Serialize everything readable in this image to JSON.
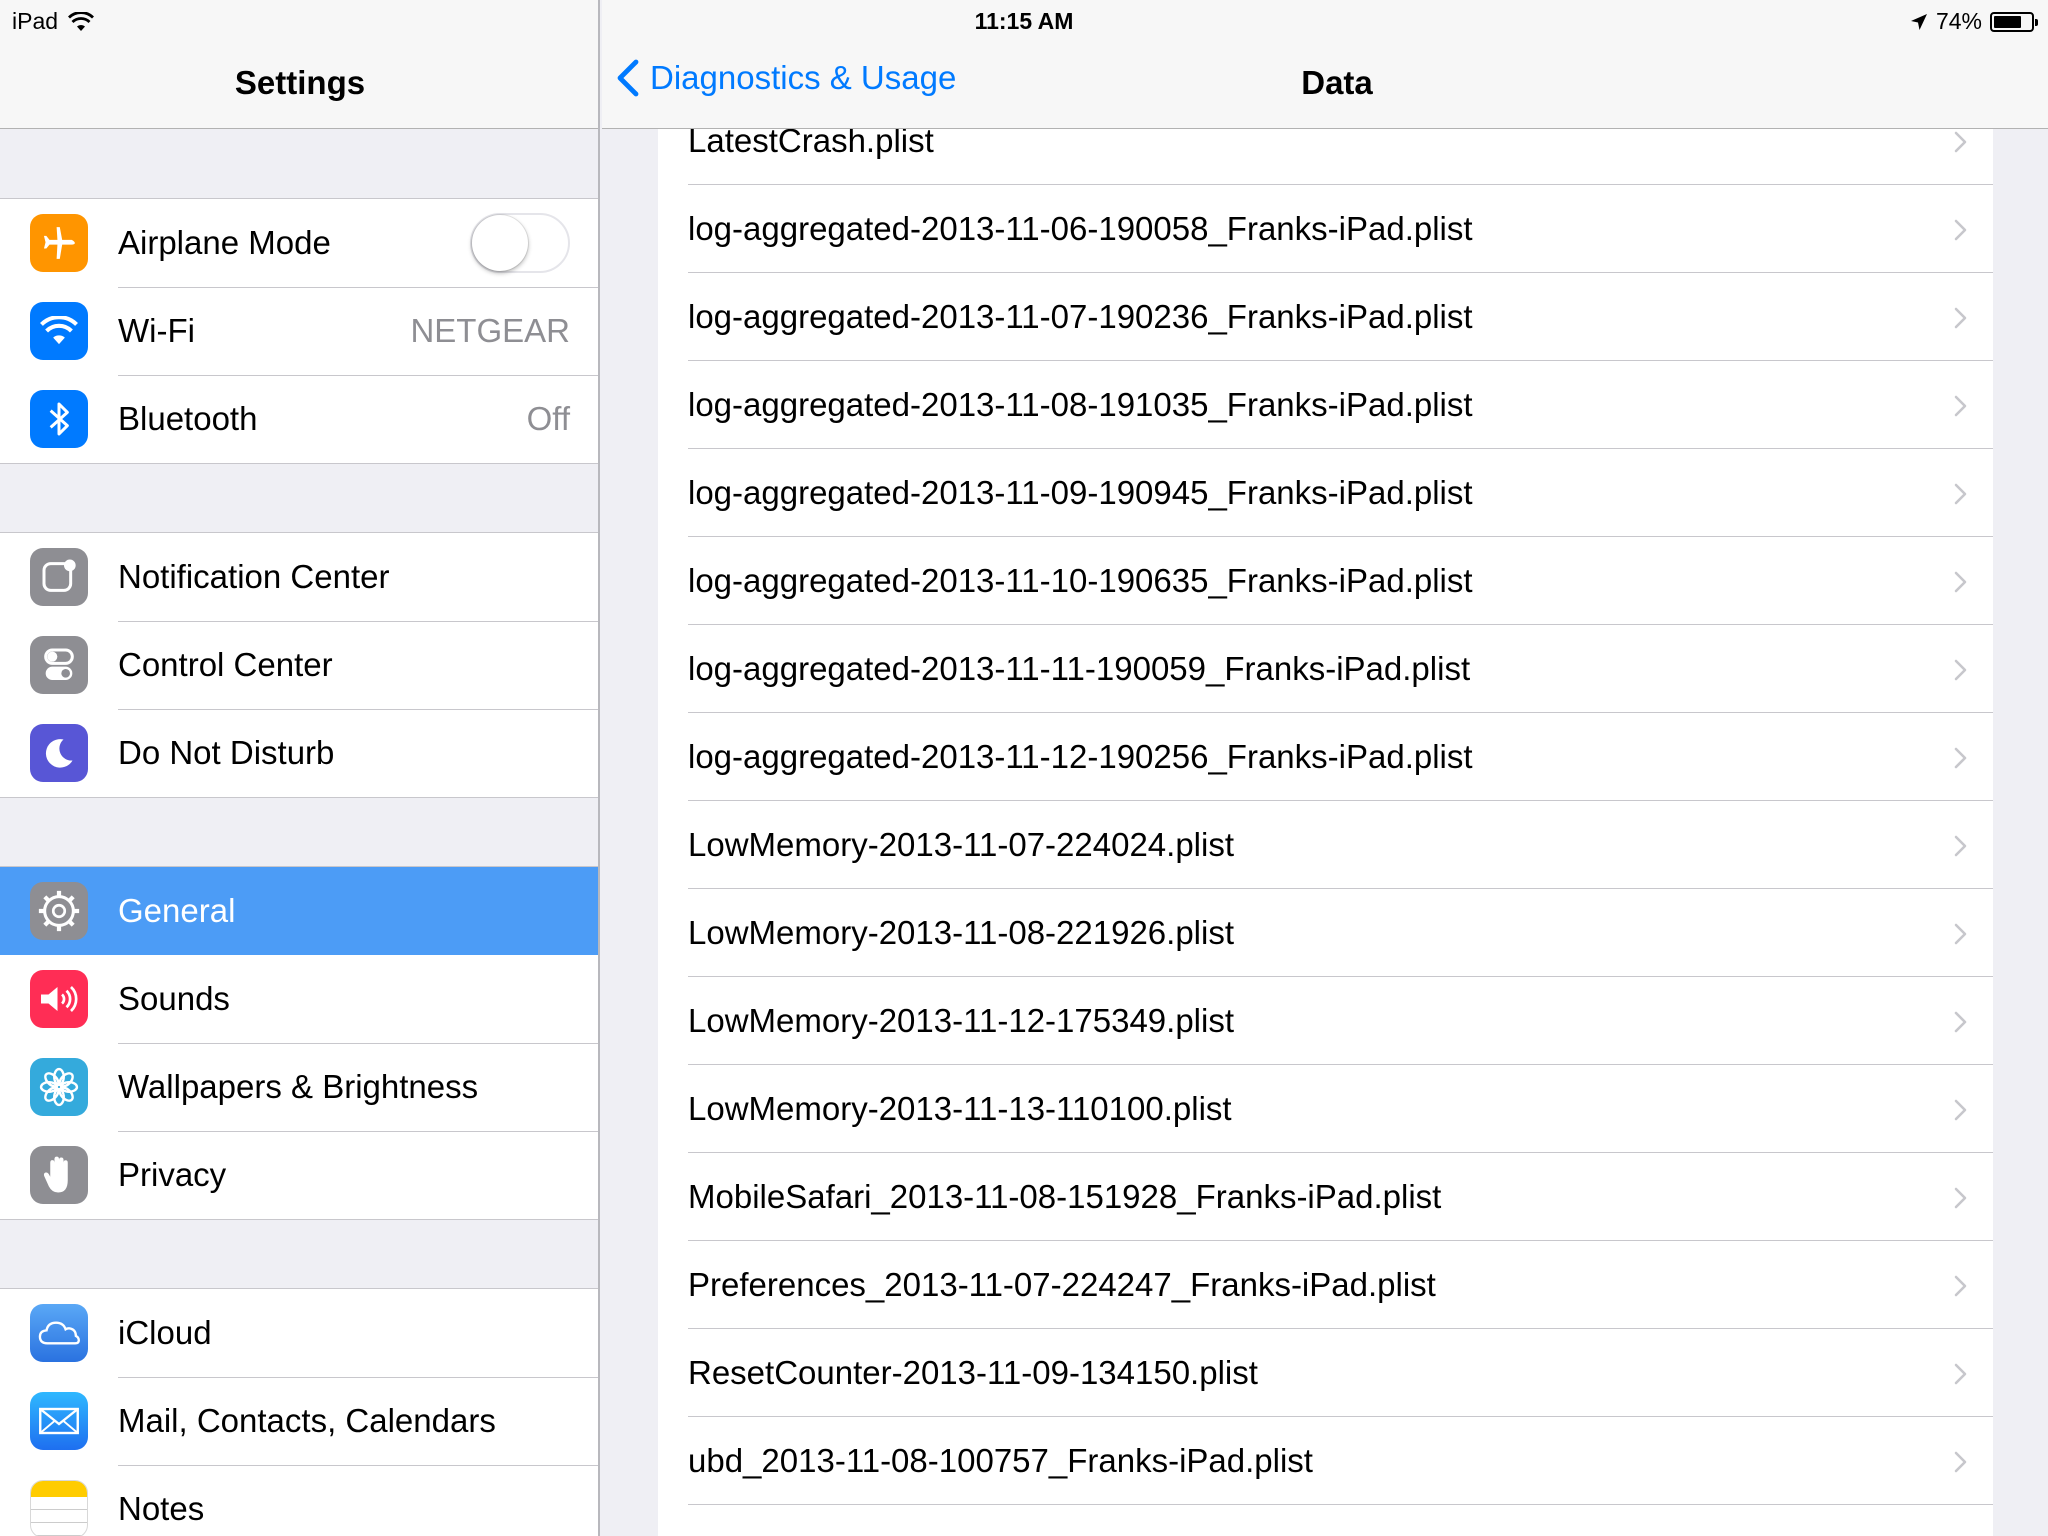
{
  "status": {
    "device": "iPad",
    "time": "11:15 AM",
    "battery": "74%",
    "battery_level": 0.74
  },
  "master": {
    "title": "Settings",
    "groups": [
      [
        {
          "label": "Airplane Mode",
          "icon": "airplane-icon",
          "color": "#ff9500",
          "toggle": false
        },
        {
          "label": "Wi-Fi",
          "value": "NETGEAR",
          "icon": "wifi-icon",
          "color": "#007aff"
        },
        {
          "label": "Bluetooth",
          "value": "Off",
          "icon": "bluetooth-icon",
          "color": "#007aff"
        }
      ],
      [
        {
          "label": "Notification Center",
          "icon": "notification-center-icon",
          "color": "#8e8e93"
        },
        {
          "label": "Control Center",
          "icon": "control-center-icon",
          "color": "#8e8e93"
        },
        {
          "label": "Do Not Disturb",
          "icon": "moon-icon",
          "color": "#5856d6"
        }
      ],
      [
        {
          "label": "General",
          "icon": "gear-icon",
          "color": "#8e8e93",
          "selected": true
        },
        {
          "label": "Sounds",
          "icon": "speaker-icon",
          "color": "#ff2d55"
        },
        {
          "label": "Wallpapers & Brightness",
          "icon": "flower-icon",
          "color": "#34aadc"
        },
        {
          "label": "Privacy",
          "icon": "hand-icon",
          "color": "#8e8e93"
        }
      ],
      [
        {
          "label": "iCloud",
          "icon": "cloud-icon",
          "color": "#3f8ff0"
        },
        {
          "label": "Mail, Contacts, Calendars",
          "icon": "envelope-icon",
          "color": "#1e90ff"
        },
        {
          "label": "Notes",
          "icon": "notes-icon",
          "color": "#ffffff"
        }
      ]
    ]
  },
  "detail": {
    "back_label": "Diagnostics & Usage",
    "title": "Data",
    "files": [
      "LatestCrash.plist",
      "log-aggregated-2013-11-06-190058_Franks-iPad.plist",
      "log-aggregated-2013-11-07-190236_Franks-iPad.plist",
      "log-aggregated-2013-11-08-191035_Franks-iPad.plist",
      "log-aggregated-2013-11-09-190945_Franks-iPad.plist",
      "log-aggregated-2013-11-10-190635_Franks-iPad.plist",
      "log-aggregated-2013-11-11-190059_Franks-iPad.plist",
      "log-aggregated-2013-11-12-190256_Franks-iPad.plist",
      "LowMemory-2013-11-07-224024.plist",
      "LowMemory-2013-11-08-221926.plist",
      "LowMemory-2013-11-12-175349.plist",
      "LowMemory-2013-11-13-110100.plist",
      "MobileSafari_2013-11-08-151928_Franks-iPad.plist",
      "Preferences_2013-11-07-224247_Franks-iPad.plist",
      "ResetCounter-2013-11-09-134150.plist",
      "ubd_2013-11-08-100757_Franks-iPad.plist"
    ]
  }
}
